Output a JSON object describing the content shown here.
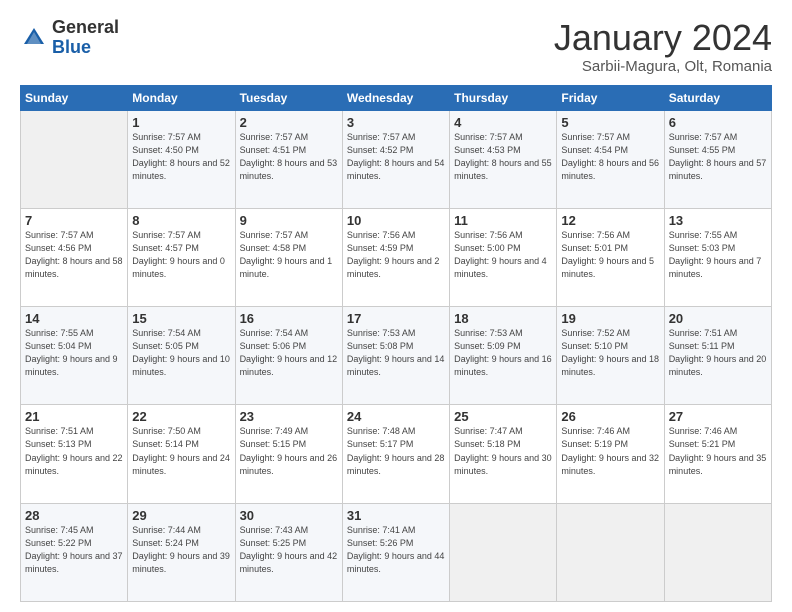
{
  "header": {
    "logo_general": "General",
    "logo_blue": "Blue",
    "month_title": "January 2024",
    "location": "Sarbii-Magura, Olt, Romania"
  },
  "columns": [
    "Sunday",
    "Monday",
    "Tuesday",
    "Wednesday",
    "Thursday",
    "Friday",
    "Saturday"
  ],
  "weeks": [
    [
      {
        "day": "",
        "info": ""
      },
      {
        "day": "1",
        "info": "Sunrise: 7:57 AM\nSunset: 4:50 PM\nDaylight: 8 hours\nand 52 minutes."
      },
      {
        "day": "2",
        "info": "Sunrise: 7:57 AM\nSunset: 4:51 PM\nDaylight: 8 hours\nand 53 minutes."
      },
      {
        "day": "3",
        "info": "Sunrise: 7:57 AM\nSunset: 4:52 PM\nDaylight: 8 hours\nand 54 minutes."
      },
      {
        "day": "4",
        "info": "Sunrise: 7:57 AM\nSunset: 4:53 PM\nDaylight: 8 hours\nand 55 minutes."
      },
      {
        "day": "5",
        "info": "Sunrise: 7:57 AM\nSunset: 4:54 PM\nDaylight: 8 hours\nand 56 minutes."
      },
      {
        "day": "6",
        "info": "Sunrise: 7:57 AM\nSunset: 4:55 PM\nDaylight: 8 hours\nand 57 minutes."
      }
    ],
    [
      {
        "day": "7",
        "info": "Sunrise: 7:57 AM\nSunset: 4:56 PM\nDaylight: 8 hours\nand 58 minutes."
      },
      {
        "day": "8",
        "info": "Sunrise: 7:57 AM\nSunset: 4:57 PM\nDaylight: 9 hours\nand 0 minutes."
      },
      {
        "day": "9",
        "info": "Sunrise: 7:57 AM\nSunset: 4:58 PM\nDaylight: 9 hours\nand 1 minute."
      },
      {
        "day": "10",
        "info": "Sunrise: 7:56 AM\nSunset: 4:59 PM\nDaylight: 9 hours\nand 2 minutes."
      },
      {
        "day": "11",
        "info": "Sunrise: 7:56 AM\nSunset: 5:00 PM\nDaylight: 9 hours\nand 4 minutes."
      },
      {
        "day": "12",
        "info": "Sunrise: 7:56 AM\nSunset: 5:01 PM\nDaylight: 9 hours\nand 5 minutes."
      },
      {
        "day": "13",
        "info": "Sunrise: 7:55 AM\nSunset: 5:03 PM\nDaylight: 9 hours\nand 7 minutes."
      }
    ],
    [
      {
        "day": "14",
        "info": "Sunrise: 7:55 AM\nSunset: 5:04 PM\nDaylight: 9 hours\nand 9 minutes."
      },
      {
        "day": "15",
        "info": "Sunrise: 7:54 AM\nSunset: 5:05 PM\nDaylight: 9 hours\nand 10 minutes."
      },
      {
        "day": "16",
        "info": "Sunrise: 7:54 AM\nSunset: 5:06 PM\nDaylight: 9 hours\nand 12 minutes."
      },
      {
        "day": "17",
        "info": "Sunrise: 7:53 AM\nSunset: 5:08 PM\nDaylight: 9 hours\nand 14 minutes."
      },
      {
        "day": "18",
        "info": "Sunrise: 7:53 AM\nSunset: 5:09 PM\nDaylight: 9 hours\nand 16 minutes."
      },
      {
        "day": "19",
        "info": "Sunrise: 7:52 AM\nSunset: 5:10 PM\nDaylight: 9 hours\nand 18 minutes."
      },
      {
        "day": "20",
        "info": "Sunrise: 7:51 AM\nSunset: 5:11 PM\nDaylight: 9 hours\nand 20 minutes."
      }
    ],
    [
      {
        "day": "21",
        "info": "Sunrise: 7:51 AM\nSunset: 5:13 PM\nDaylight: 9 hours\nand 22 minutes."
      },
      {
        "day": "22",
        "info": "Sunrise: 7:50 AM\nSunset: 5:14 PM\nDaylight: 9 hours\nand 24 minutes."
      },
      {
        "day": "23",
        "info": "Sunrise: 7:49 AM\nSunset: 5:15 PM\nDaylight: 9 hours\nand 26 minutes."
      },
      {
        "day": "24",
        "info": "Sunrise: 7:48 AM\nSunset: 5:17 PM\nDaylight: 9 hours\nand 28 minutes."
      },
      {
        "day": "25",
        "info": "Sunrise: 7:47 AM\nSunset: 5:18 PM\nDaylight: 9 hours\nand 30 minutes."
      },
      {
        "day": "26",
        "info": "Sunrise: 7:46 AM\nSunset: 5:19 PM\nDaylight: 9 hours\nand 32 minutes."
      },
      {
        "day": "27",
        "info": "Sunrise: 7:46 AM\nSunset: 5:21 PM\nDaylight: 9 hours\nand 35 minutes."
      }
    ],
    [
      {
        "day": "28",
        "info": "Sunrise: 7:45 AM\nSunset: 5:22 PM\nDaylight: 9 hours\nand 37 minutes."
      },
      {
        "day": "29",
        "info": "Sunrise: 7:44 AM\nSunset: 5:24 PM\nDaylight: 9 hours\nand 39 minutes."
      },
      {
        "day": "30",
        "info": "Sunrise: 7:43 AM\nSunset: 5:25 PM\nDaylight: 9 hours\nand 42 minutes."
      },
      {
        "day": "31",
        "info": "Sunrise: 7:41 AM\nSunset: 5:26 PM\nDaylight: 9 hours\nand 44 minutes."
      },
      {
        "day": "",
        "info": ""
      },
      {
        "day": "",
        "info": ""
      },
      {
        "day": "",
        "info": ""
      }
    ]
  ]
}
